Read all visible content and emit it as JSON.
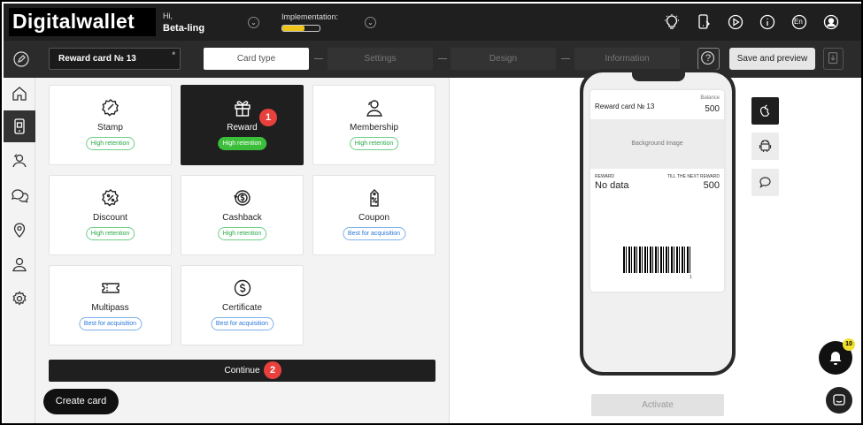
{
  "header": {
    "logo": "Digitalwallet",
    "greeting": "Hi,",
    "user_name": "Beta-ling",
    "implementation_label": "Implementation:",
    "implementation_progress": 0.6,
    "language": "En"
  },
  "toolbar": {
    "card_name": "Reward card № 13",
    "required_mark": "*",
    "steps": [
      "Card type",
      "Settings",
      "Design",
      "Information"
    ],
    "help_label": "?",
    "save_label": "Save and preview"
  },
  "card_types": [
    {
      "name": "Stamp",
      "badge": "High retention",
      "badge_kind": "green",
      "icon": "stamp-icon"
    },
    {
      "name": "Reward",
      "badge": "High retention",
      "badge_kind": "green",
      "icon": "gift-icon",
      "selected": true
    },
    {
      "name": "Membership",
      "badge": "High retention",
      "badge_kind": "green",
      "icon": "membership-icon"
    },
    {
      "name": "Discount",
      "badge": "High retention",
      "badge_kind": "green",
      "icon": "discount-icon"
    },
    {
      "name": "Cashback",
      "badge": "High retention",
      "badge_kind": "green",
      "icon": "cashback-icon"
    },
    {
      "name": "Coupon",
      "badge": "Best for acquisition",
      "badge_kind": "blue",
      "icon": "coupon-icon"
    },
    {
      "name": "Multipass",
      "badge": "Best for acquisition",
      "badge_kind": "blue",
      "icon": "ticket-icon"
    },
    {
      "name": "Certificate",
      "badge": "Best for acquisition",
      "badge_kind": "blue",
      "icon": "certificate-icon"
    }
  ],
  "markers": [
    "1",
    "2"
  ],
  "actions": {
    "continue_label": "Continue",
    "create_card_label": "Create card",
    "activate_label": "Activate"
  },
  "pass": {
    "title": "Reward card № 13",
    "balance_label": "Balance",
    "balance_value": "500",
    "background_label": "Background image",
    "reward_label": "REWARD",
    "reward_value": "No data",
    "next_label": "TILL THE NEXT REWARD",
    "next_value": "500",
    "barcode_number": "1"
  },
  "notifications": {
    "count": "10"
  },
  "colors": {
    "dark": "#1f1f1f",
    "green_badge": "#3bbf3b",
    "marker_red": "#e8403d",
    "progress_yellow": "#f0c419"
  }
}
